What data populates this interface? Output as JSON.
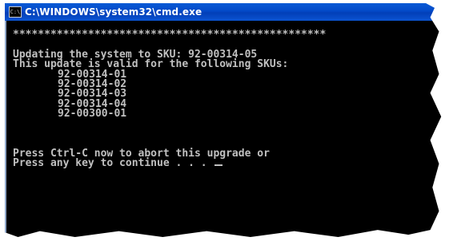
{
  "window": {
    "title": "C:\\WINDOWS\\system32\\cmd.exe",
    "icon": "cmd-icon",
    "icon_glyph": "C:\\"
  },
  "console": {
    "separator": "**************************************************",
    "line_update": "Updating the system to SKU: 92-00314-05",
    "line_valid": "This update is valid for the following SKUs:",
    "skus": [
      "92-00314-01",
      "92-00314-02",
      "92-00314-03",
      "92-00314-04",
      "92-00300-01"
    ],
    "prompt_abort": "Press Ctrl-C now to abort this upgrade or",
    "prompt_continue": "Press any key to continue . . . "
  },
  "colors": {
    "titlebar": "#0349c8",
    "console_bg": "#000000",
    "console_fg": "#c0c0c0"
  }
}
